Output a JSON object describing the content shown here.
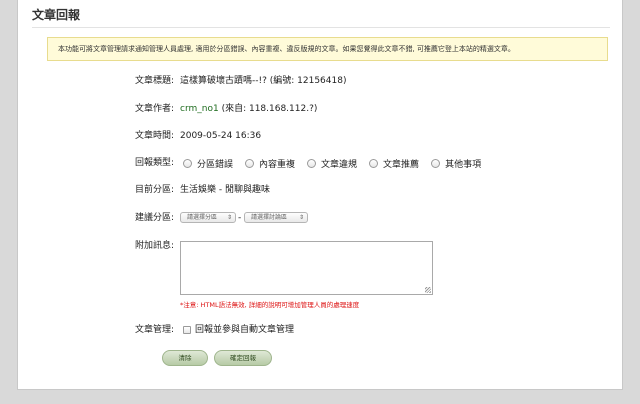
{
  "header": {
    "title": "文章回報"
  },
  "notice": "本功能可將文章管理請求通知管理人員處理, 適用於分區錯誤、內容重複、違反版規的文章。如果您覺得此文章不錯, 可推薦它登上本站的精選文章。",
  "fields": {
    "subject_label": "文章標題:",
    "subject_value": "這樣算破壞古蹟嗎--!? (編號: 12156418)",
    "author_label": "文章作者:",
    "author_name": "crm_no1",
    "author_from": " (來自: 118.168.112.?)",
    "time_label": "文章時間:",
    "time_value": "2009-05-24 16:36",
    "type_label": "回報類型:",
    "type_options": [
      "分區錯誤",
      "內容重複",
      "文章違規",
      "文章推薦",
      "其他事項"
    ],
    "current_label": "目前分區:",
    "current_value": "生活娛樂 - 閒聊與趣味",
    "suggest_label": "建議分區:",
    "suggest_select1": "請選擇分區",
    "suggest_separator": "-",
    "suggest_select2": "請選擇討論區",
    "extra_label": "附加訊息:",
    "extra_value": "",
    "hint": "*注意: HTML語法無效, 詳細的說明可增加管理人員的處理速度",
    "manage_label": "文章管理:",
    "manage_checkbox": "回報並參與自動文章管理"
  },
  "buttons": {
    "clear": "清除",
    "submit": "確定回報"
  },
  "colors": {
    "notice_bg": "#fffbd9",
    "hint": "#dd1111",
    "link": "#1d6b1d",
    "button_bg": "#b7cba6"
  }
}
